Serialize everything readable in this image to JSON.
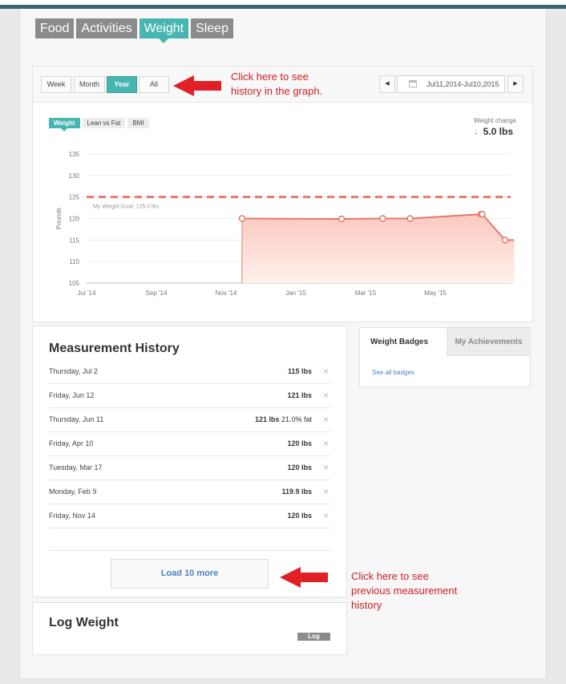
{
  "tabs": [
    "Food",
    "Activities",
    "Weight",
    "Sleep"
  ],
  "active_tab": "Weight",
  "range_buttons": [
    "Week",
    "Month",
    "Year",
    "All"
  ],
  "active_range": "Year",
  "nav": {
    "prev_icon": "triangle-left-icon",
    "next_icon": "triangle-right-icon"
  },
  "date_range": "Jul11,2014-Jul10,2015",
  "annotations": {
    "graph": [
      "Click here to see",
      "history in the graph."
    ],
    "history": [
      "Click here to see",
      "previous measurement",
      "history"
    ]
  },
  "graph_tabs": [
    "Weight",
    "Lean vs Fat",
    "BMI"
  ],
  "weight_change": {
    "label": "Weight change",
    "value": "5.0 lbs",
    "direction_icon": "down-arrow-icon"
  },
  "chart_data": {
    "type": "area",
    "ylabel": "Pounds",
    "ylim": [
      105,
      135
    ],
    "yticks": [
      "135",
      "130",
      "125",
      "120",
      "115",
      "110",
      "105"
    ],
    "xticks": [
      "Jul '14",
      "Sep '14",
      "Nov '14",
      "Jan '15",
      "Mar '15",
      "May '15"
    ],
    "series": [
      {
        "x": [
          "2014-11-14",
          "2015-02-09",
          "2015-03-17",
          "2015-04-10",
          "2015-06-11",
          "2015-06-12",
          "2015-07-02"
        ],
        "values": [
          120,
          119.9,
          120,
          120,
          121,
          121,
          115
        ]
      }
    ],
    "goal": {
      "label": "My Weight Goal: 125.0 lbs",
      "value": 125
    },
    "colors": {
      "line": "#e3796a",
      "fill": "#fde0da",
      "goal": "#e3796a"
    }
  },
  "history": {
    "title": "Measurement History",
    "rows": [
      {
        "date": "Thursday, Jul 2",
        "value": "115 lbs",
        "extra": ""
      },
      {
        "date": "Friday, Jun 12",
        "value": "121 lbs",
        "extra": ""
      },
      {
        "date": "Thursday, Jun 11",
        "value": "121 lbs",
        "extra": " 21.0% fat"
      },
      {
        "date": "Friday, Apr 10",
        "value": "120 lbs",
        "extra": ""
      },
      {
        "date": "Tuesday, Mar 17",
        "value": "120 lbs",
        "extra": ""
      },
      {
        "date": "Monday, Feb 9",
        "value": "119.9 lbs",
        "extra": ""
      },
      {
        "date": "Friday, Nov 14",
        "value": "120 lbs",
        "extra": ""
      }
    ],
    "delete_icon": "×",
    "load_more": "Load 10 more"
  },
  "log": {
    "title": "Log Weight",
    "button": "Log"
  },
  "badges": {
    "tabs": [
      "Weight Badges",
      "My Achievements"
    ],
    "link": "See all badges"
  },
  "colors": {
    "accent": "#47b5b0",
    "tab_bg": "#8b8b8b",
    "annotation": "#cc2027",
    "link": "#4a82c4"
  }
}
